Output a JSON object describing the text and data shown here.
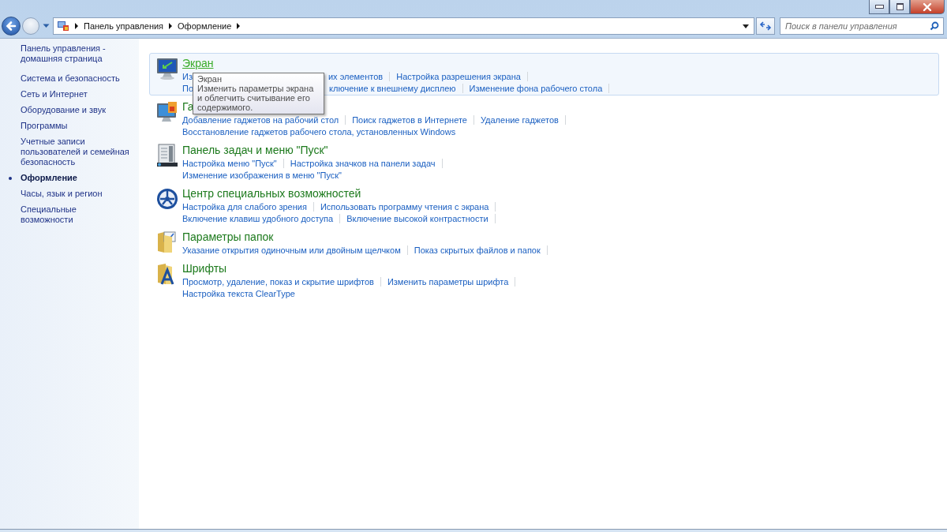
{
  "address_bar": {
    "breadcrumbs": [
      "Панель управления",
      "Оформление"
    ]
  },
  "search": {
    "placeholder": "Поиск в панели управления"
  },
  "sidebar": {
    "home": "Панель управления - домашняя страница",
    "items": [
      {
        "label": "Система и безопасность",
        "selected": false
      },
      {
        "label": "Сеть и Интернет",
        "selected": false
      },
      {
        "label": "Оборудование и звук",
        "selected": false
      },
      {
        "label": "Программы",
        "selected": false
      },
      {
        "label": "Учетные записи пользователей и семейная безопасность",
        "selected": false
      },
      {
        "label": "Оформление",
        "selected": true
      },
      {
        "label": "Часы, язык и регион",
        "selected": false
      },
      {
        "label": "Специальные возможности",
        "selected": false
      }
    ]
  },
  "sections": [
    {
      "title": "Экран",
      "hovered": true,
      "link_rows": [
        [
          {
            "text": "Из",
            "text_after": "их элементов"
          },
          {
            "text": "Настройка разрешения экрана"
          }
        ],
        [
          {
            "text": "По",
            "text_after": "ключение к внешнему дисплею"
          },
          {
            "text": "Изменение фона рабочего стола"
          }
        ]
      ]
    },
    {
      "title": "Га",
      "hovered": false,
      "link_rows": [
        [
          {
            "text": "Добавление гаджетов на рабочий стол"
          },
          {
            "text": "Поиск гаджетов в Интернете"
          },
          {
            "text": "Удаление гаджетов"
          }
        ],
        [
          {
            "text": "Восстановление гаджетов рабочего стола, установленных Windows"
          }
        ]
      ]
    },
    {
      "title": "Панель задач и меню \"Пуск\"",
      "hovered": false,
      "link_rows": [
        [
          {
            "text": "Настройка меню \"Пуск\""
          },
          {
            "text": "Настройка значков на панели задач"
          }
        ],
        [
          {
            "text": "Изменение изображения в меню \"Пуск\""
          }
        ]
      ]
    },
    {
      "title": "Центр специальных возможностей",
      "hovered": false,
      "link_rows": [
        [
          {
            "text": "Настройка для слабого зрения"
          },
          {
            "text": "Использовать программу чтения с экрана"
          }
        ],
        [
          {
            "text": "Включение клавиш удобного доступа"
          },
          {
            "text": "Включение высокой контрастности"
          }
        ]
      ]
    },
    {
      "title": "Параметры папок",
      "hovered": false,
      "link_rows": [
        [
          {
            "text": "Указание открытия одиночным или двойным щелчком"
          },
          {
            "text": "Показ скрытых файлов и папок"
          }
        ]
      ]
    },
    {
      "title": "Шрифты",
      "hovered": false,
      "link_rows": [
        [
          {
            "text": "Просмотр, удаление, показ и скрытие шрифтов"
          },
          {
            "text": "Изменить параметры шрифта"
          }
        ],
        [
          {
            "text": "Настройка текста ClearType"
          }
        ]
      ]
    }
  ],
  "tooltip": {
    "title": "Экран",
    "text": "Изменить параметры экрана и облегчить считывание его содержимого."
  }
}
